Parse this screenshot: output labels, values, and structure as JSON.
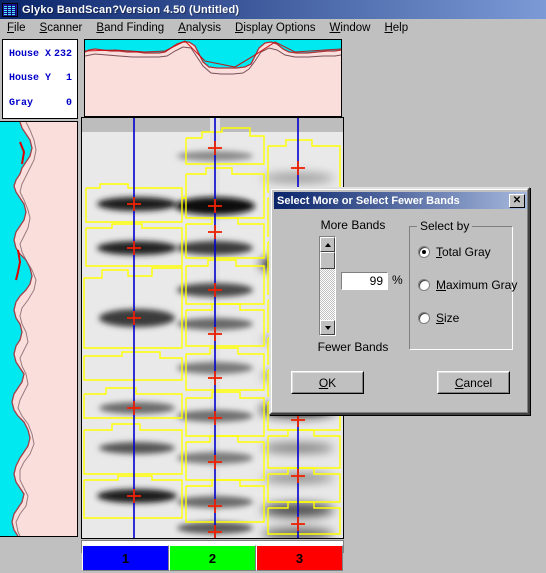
{
  "window": {
    "title": "Glyko BandScan?Version 4.50 (Untitled)",
    "icon": "gel-lanes-icon"
  },
  "menubar": {
    "items": [
      {
        "acc": "F",
        "rest": "ile",
        "name": "menu-file"
      },
      {
        "acc": "S",
        "rest": "canner",
        "name": "menu-scanner"
      },
      {
        "acc": "B",
        "rest": "and Finding",
        "name": "menu-band-finding"
      },
      {
        "acc": "A",
        "rest": "nalysis",
        "name": "menu-analysis"
      },
      {
        "acc": "D",
        "rest": "isplay Options",
        "name": "menu-display-options"
      },
      {
        "acc": "W",
        "rest": "indow",
        "name": "menu-window"
      },
      {
        "acc": "H",
        "rest": "elp",
        "name": "menu-help"
      }
    ]
  },
  "info_panel": {
    "rows": [
      {
        "label": "House X",
        "value": "232"
      },
      {
        "label": "House Y",
        "value": "1"
      },
      {
        "label": "Gray",
        "value": "0"
      }
    ],
    "text_color": "#0000c8"
  },
  "plots": {
    "profile_fill": "#fadedc",
    "profile_background": "#00e8f0",
    "trace_color": "#803038",
    "highlight_color": "#cc0000"
  },
  "gel": {
    "lane_line_color": "#0000cc",
    "band_outline_color": "#ffff00",
    "marker_color": "#ee2200",
    "lane_count": 3
  },
  "lanes": {
    "buttons": [
      {
        "label": "1",
        "color": "#0000ff",
        "text_color": "#000000"
      },
      {
        "label": "2",
        "color": "#00ff00",
        "text_color": "#000000"
      },
      {
        "label": "3",
        "color": "#ff0000",
        "text_color": "#000000"
      }
    ]
  },
  "dialog": {
    "title": "Select More or Select Fewer Bands",
    "close_label": "✕",
    "more_bands_label": "More Bands",
    "fewer_bands_label": "Fewer Bands",
    "value": "99",
    "percent_label": "%",
    "group_legend": "Select by",
    "radios": [
      {
        "acc": "T",
        "rest": "otal Gray",
        "pre": "",
        "checked": true,
        "name": "radio-total-gray"
      },
      {
        "acc": "M",
        "rest": "aximum Gray",
        "pre": "",
        "checked": false,
        "name": "radio-maximum-gray"
      },
      {
        "acc": "S",
        "rest": "ize",
        "pre": "",
        "checked": false,
        "name": "radio-size"
      }
    ],
    "ok": {
      "acc": "O",
      "rest": "K"
    },
    "cancel": {
      "acc": "C",
      "rest": "ancel"
    }
  }
}
